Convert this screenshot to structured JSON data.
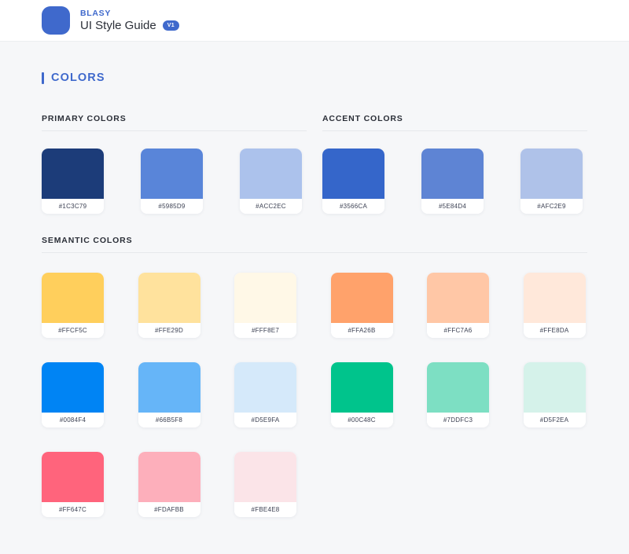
{
  "header": {
    "logo_icon": "app-logo-squircle",
    "brand_name": "BLASY",
    "title": "UI Style Guide",
    "version_badge": "V1",
    "brand_color": "#3F69CC"
  },
  "section": {
    "title": "COLORS",
    "accent_color": "#3F69CC"
  },
  "groups": [
    {
      "id": "primary-colors",
      "label": "PRIMARY COLORS",
      "swatches": [
        {
          "hex": "#1C3C79",
          "label": "#1C3C79"
        },
        {
          "hex": "#5985D9",
          "label": "#5985D9"
        },
        {
          "hex": "#ACC2EC",
          "label": "#ACC2EC"
        }
      ]
    },
    {
      "id": "accent-colors",
      "label": "ACCENT COLORS",
      "swatches": [
        {
          "hex": "#3566CA",
          "label": "#3566CA"
        },
        {
          "hex": "#5E84D4",
          "label": "#5E84D4"
        },
        {
          "hex": "#AFC2E9",
          "label": "#AFC2E9"
        }
      ]
    }
  ],
  "semantic": {
    "id": "semantic-colors",
    "label": "SEMANTIC COLORS",
    "swatches": [
      {
        "hex": "#FFCF5C",
        "label": "#FFCF5C"
      },
      {
        "hex": "#FFE29D",
        "label": "#FFE29D"
      },
      {
        "hex": "#FFF8E7",
        "label": "#FFF8E7"
      },
      {
        "hex": "#FFA26B",
        "label": "#FFA26B"
      },
      {
        "hex": "#FFC7A6",
        "label": "#FFC7A6"
      },
      {
        "hex": "#FFE8DA",
        "label": "#FFE8DA"
      },
      {
        "hex": "#0084F4",
        "label": "#0084F4"
      },
      {
        "hex": "#66B5F8",
        "label": "#66B5F8"
      },
      {
        "hex": "#D5E9FA",
        "label": "#D5E9FA"
      },
      {
        "hex": "#00C48C",
        "label": "#00C48C"
      },
      {
        "hex": "#7DDFC3",
        "label": "#7DDFC3"
      },
      {
        "hex": "#D5F2EA",
        "label": "#D5F2EA"
      },
      {
        "hex": "#FF647C",
        "label": "#FF647C"
      },
      {
        "hex": "#FDAFBB",
        "label": "#FDAFBB"
      },
      {
        "hex": "#FBE4E8",
        "label": "#FBE4E8"
      }
    ]
  }
}
